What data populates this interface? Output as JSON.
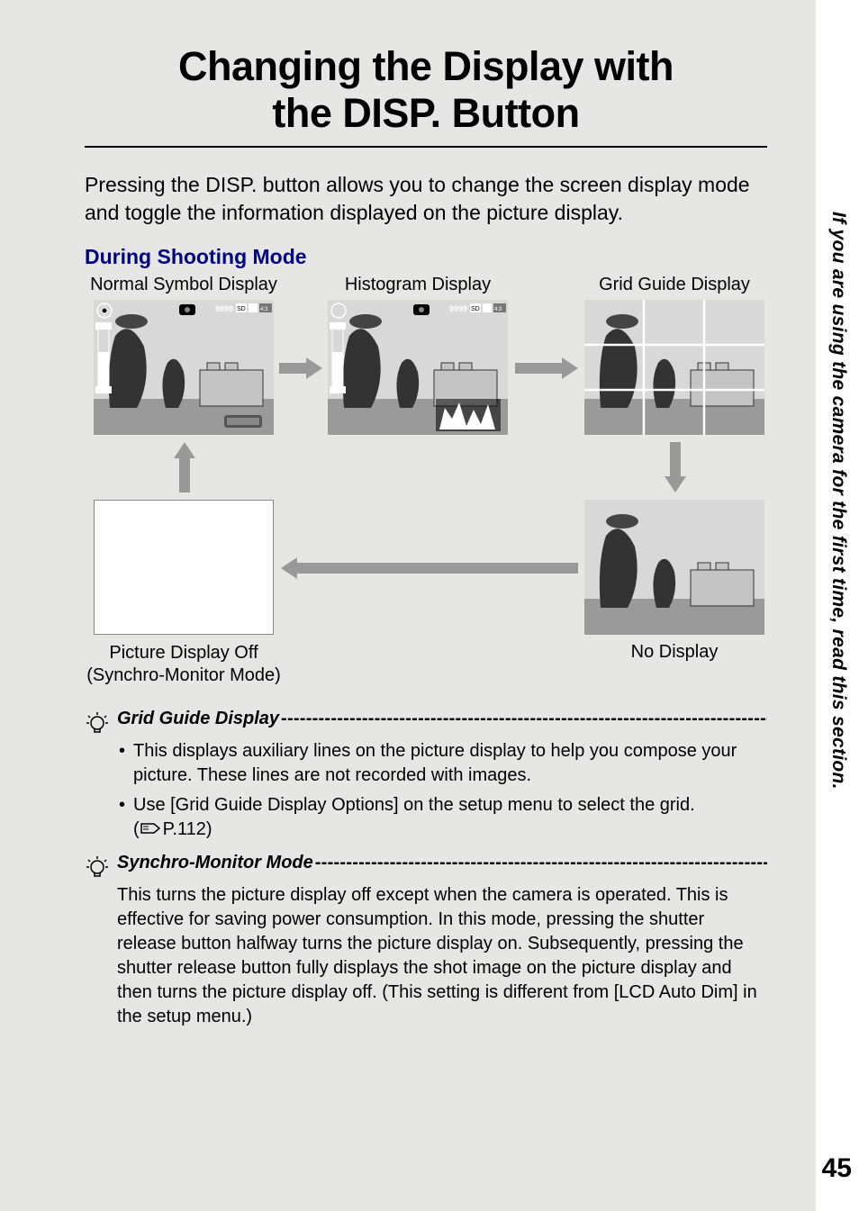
{
  "side_tab_text": "If you are using the camera for the first time, read this section.",
  "page_number": "45",
  "title_line1": "Changing the Display with",
  "title_line2": "the DISP. Button",
  "intro": "Pressing the DISP. button allows you to change the screen display mode and toggle the information displayed on the picture display.",
  "subheading": "During Shooting Mode",
  "labels": {
    "normal": "Normal Symbol Display",
    "histogram": "Histogram Display",
    "grid": "Grid Guide Display",
    "pic_off_l1": "Picture Display Off",
    "pic_off_l2": "(Synchro-Monitor Mode)",
    "no_display": "No Display"
  },
  "thumb_overlay": {
    "count": "9999",
    "badges": "SD IN 4:3 F"
  },
  "notes": {
    "grid": {
      "title": "Grid Guide Display",
      "bullets": [
        "This displays auxiliary lines on the picture display to help you compose your picture. These lines are not recorded with images.",
        "Use [Grid Guide Display Options] on the setup menu to select the grid."
      ],
      "pageref": "P.112"
    },
    "synchro": {
      "title": "Synchro-Monitor Mode",
      "body": "This turns the picture display off except when the camera is operated. This is effective for saving power consumption. In this mode, pressing the shutter release button halfway turns the picture display on. Subsequently, pressing the shutter release button fully displays the shot image on the picture display and then turns the picture display off. (This setting is different from [LCD Auto Dim] in the setup menu.)"
    }
  },
  "dashes": "-------------------------------------------------------------------------------------------------------------"
}
